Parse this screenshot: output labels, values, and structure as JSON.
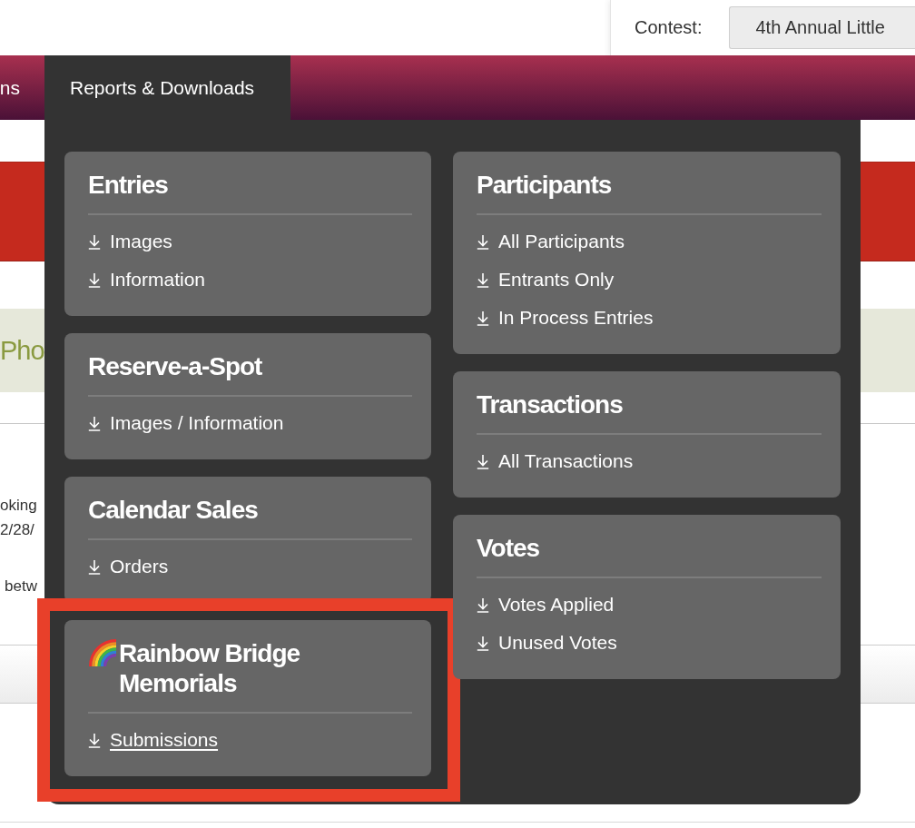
{
  "top_bar": {
    "contest_label": "Contest:",
    "contest_value": "4th Annual Little"
  },
  "nav": {
    "tabs": [
      {
        "label": "ns",
        "selected": false
      },
      {
        "label": "Reports & Downloads",
        "selected": true
      }
    ]
  },
  "background_page": {
    "heading_fragment": "Pho",
    "text_fragments": [
      "oking",
      "2/28/",
      "betw"
    ]
  },
  "dropdown": {
    "columns": [
      {
        "sections": [
          {
            "title": "Entries",
            "title_icon": false,
            "highlighted": false,
            "items": [
              {
                "label": "Images",
                "hovered": false
              },
              {
                "label": "Information",
                "hovered": false
              }
            ]
          },
          {
            "title": "Reserve-a-Spot",
            "title_icon": false,
            "highlighted": false,
            "items": [
              {
                "label": "Images / Information",
                "hovered": false
              }
            ]
          },
          {
            "title": "Calendar Sales",
            "title_icon": false,
            "highlighted": false,
            "items": [
              {
                "label": "Orders",
                "hovered": false
              }
            ]
          },
          {
            "title": "Rainbow Bridge Memorials",
            "title_icon": true,
            "highlighted": true,
            "items": [
              {
                "label": "Submissions",
                "hovered": true
              }
            ]
          }
        ]
      },
      {
        "sections": [
          {
            "title": "Participants",
            "title_icon": false,
            "highlighted": false,
            "items": [
              {
                "label": "All Participants",
                "hovered": false
              },
              {
                "label": "Entrants Only",
                "hovered": false
              },
              {
                "label": "In Process Entries",
                "hovered": false
              }
            ]
          },
          {
            "title": "Transactions",
            "title_icon": false,
            "highlighted": false,
            "items": [
              {
                "label": "All Transactions",
                "hovered": false
              }
            ]
          },
          {
            "title": "Votes",
            "title_icon": false,
            "highlighted": false,
            "items": [
              {
                "label": "Votes Applied",
                "hovered": false
              },
              {
                "label": "Unused Votes",
                "hovered": false
              }
            ]
          }
        ]
      }
    ]
  }
}
